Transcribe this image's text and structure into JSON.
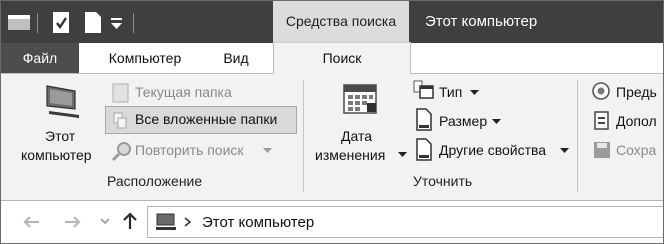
{
  "title_bar": {
    "contextual_tab_group": "Средства поиска",
    "window_title": "Этот компьютер"
  },
  "tabs": {
    "file": "Файл",
    "computer": "Компьютер",
    "view": "Вид",
    "search": "Поиск"
  },
  "ribbon": {
    "location_group": {
      "this_pc_line1": "Этот",
      "this_pc_line2": "компьютер",
      "current_folder": "Текущая папка",
      "all_subfolders": "Все вложенные папки",
      "search_again": "Повторить поиск",
      "label": "Расположение"
    },
    "refine_group": {
      "date_modified_line1": "Дата",
      "date_modified_line2": "изменения",
      "kind": "Тип",
      "size": "Размер",
      "other_properties": "Другие свойства",
      "label": "Уточнить"
    },
    "options_group": {
      "recent_searches": "Предь",
      "advanced_options": "Допол",
      "save_search": "Сохра"
    }
  },
  "address_bar": {
    "path": "Этот компьютер"
  },
  "icons": {
    "back": "back-arrow-icon",
    "forward": "forward-arrow-icon",
    "recent": "chevron-down-icon",
    "up": "up-arrow-icon",
    "location": "computer-icon"
  },
  "colors": {
    "title_bar": "#3f3f3f",
    "file_tab": "#4d4d4d",
    "contextual_tab": "#dcdcdc",
    "ribbon": "#f2f2f2",
    "selected_option": "#d9d9d9"
  }
}
